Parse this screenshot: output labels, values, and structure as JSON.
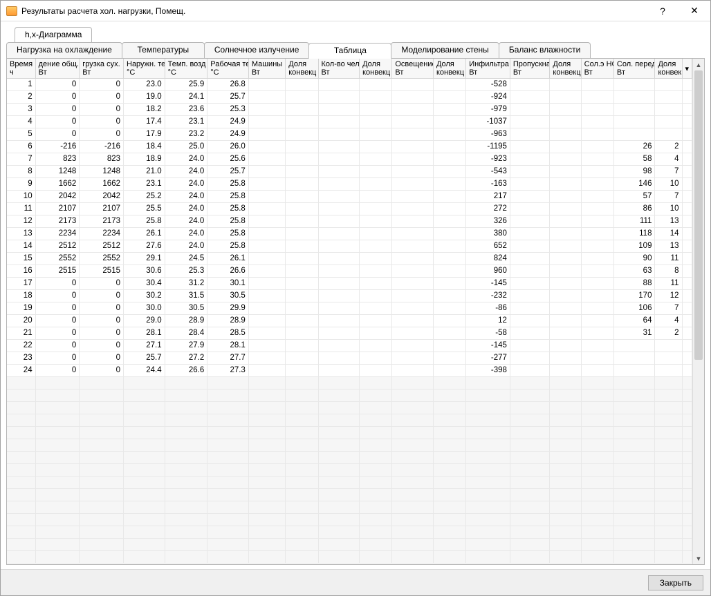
{
  "window": {
    "title": "Результаты расчета хол. нагрузки, Помещ.",
    "help": "?",
    "close": "✕"
  },
  "subtabs": {
    "diagram": "h,x-Диаграмма"
  },
  "tabs": {
    "cooling": "Нагрузка на охлаждение",
    "temps": "Температуры",
    "solar": "Солнечное излучение",
    "table": "Таблица",
    "wall": "Моделирование стены",
    "humidity": "Баланс влажности"
  },
  "columns": [
    {
      "l1": "Время",
      "l2": "ч"
    },
    {
      "l1": "дение общ.",
      "l2": "Вт"
    },
    {
      "l1": "грузка сух.",
      "l2": "Вт"
    },
    {
      "l1": "Наружн. те",
      "l2": "°C"
    },
    {
      "l1": "Темп. возд",
      "l2": "°C"
    },
    {
      "l1": "Рабочая те",
      "l2": "°C"
    },
    {
      "l1": "Машины",
      "l2": "Вт"
    },
    {
      "l1": "Доля",
      "l2": "конвекц"
    },
    {
      "l1": "Кол-во чел.",
      "l2": "Вт"
    },
    {
      "l1": "Доля",
      "l2": "конвекц"
    },
    {
      "l1": "Освещение",
      "l2": "Вт"
    },
    {
      "l1": "Доля",
      "l2": "конвекц"
    },
    {
      "l1": "Инфильтра",
      "l2": "Вт"
    },
    {
      "l1": "Пропускна",
      "l2": "Вт"
    },
    {
      "l1": "Доля",
      "l2": "конвекц"
    },
    {
      "l1": "Сол.э НС",
      "l2": "Вт"
    },
    {
      "l1": "Сол. перед",
      "l2": "Вт"
    },
    {
      "l1": "Доля",
      "l2": "конвекц"
    }
  ],
  "rows": [
    {
      "t": 1,
      "tot": 0,
      "dry": 0,
      "out": "23.0",
      "air": "25.9",
      "op": "26.8",
      "inf": -528,
      "sol": "",
      "kc": ""
    },
    {
      "t": 2,
      "tot": 0,
      "dry": 0,
      "out": "19.0",
      "air": "24.1",
      "op": "25.7",
      "inf": -924,
      "sol": "",
      "kc": ""
    },
    {
      "t": 3,
      "tot": 0,
      "dry": 0,
      "out": "18.2",
      "air": "23.6",
      "op": "25.3",
      "inf": -979,
      "sol": "",
      "kc": ""
    },
    {
      "t": 4,
      "tot": 0,
      "dry": 0,
      "out": "17.4",
      "air": "23.1",
      "op": "24.9",
      "inf": -1037,
      "sol": "",
      "kc": ""
    },
    {
      "t": 5,
      "tot": 0,
      "dry": 0,
      "out": "17.9",
      "air": "23.2",
      "op": "24.9",
      "inf": -963,
      "sol": "",
      "kc": ""
    },
    {
      "t": 6,
      "tot": -216,
      "dry": -216,
      "out": "18.4",
      "air": "25.0",
      "op": "26.0",
      "inf": -1195,
      "sol": 26,
      "kc": 2
    },
    {
      "t": 7,
      "tot": 823,
      "dry": 823,
      "out": "18.9",
      "air": "24.0",
      "op": "25.6",
      "inf": -923,
      "sol": 58,
      "kc": 4
    },
    {
      "t": 8,
      "tot": 1248,
      "dry": 1248,
      "out": "21.0",
      "air": "24.0",
      "op": "25.7",
      "inf": -543,
      "sol": 98,
      "kc": 7
    },
    {
      "t": 9,
      "tot": 1662,
      "dry": 1662,
      "out": "23.1",
      "air": "24.0",
      "op": "25.8",
      "inf": -163,
      "sol": 146,
      "kc": 10
    },
    {
      "t": 10,
      "tot": 2042,
      "dry": 2042,
      "out": "25.2",
      "air": "24.0",
      "op": "25.8",
      "inf": 217,
      "sol": 57,
      "kc": 7
    },
    {
      "t": 11,
      "tot": 2107,
      "dry": 2107,
      "out": "25.5",
      "air": "24.0",
      "op": "25.8",
      "inf": 272,
      "sol": 86,
      "kc": 10
    },
    {
      "t": 12,
      "tot": 2173,
      "dry": 2173,
      "out": "25.8",
      "air": "24.0",
      "op": "25.8",
      "inf": 326,
      "sol": 111,
      "kc": 13
    },
    {
      "t": 13,
      "tot": 2234,
      "dry": 2234,
      "out": "26.1",
      "air": "24.0",
      "op": "25.8",
      "inf": 380,
      "sol": 118,
      "kc": 14
    },
    {
      "t": 14,
      "tot": 2512,
      "dry": 2512,
      "out": "27.6",
      "air": "24.0",
      "op": "25.8",
      "inf": 652,
      "sol": 109,
      "kc": 13
    },
    {
      "t": 15,
      "tot": 2552,
      "dry": 2552,
      "out": "29.1",
      "air": "24.5",
      "op": "26.1",
      "inf": 824,
      "sol": 90,
      "kc": 11
    },
    {
      "t": 16,
      "tot": 2515,
      "dry": 2515,
      "out": "30.6",
      "air": "25.3",
      "op": "26.6",
      "inf": 960,
      "sol": 63,
      "kc": 8
    },
    {
      "t": 17,
      "tot": 0,
      "dry": 0,
      "out": "30.4",
      "air": "31.2",
      "op": "30.1",
      "inf": -145,
      "sol": 88,
      "kc": 11
    },
    {
      "t": 18,
      "tot": 0,
      "dry": 0,
      "out": "30.2",
      "air": "31.5",
      "op": "30.5",
      "inf": -232,
      "sol": 170,
      "kc": 12
    },
    {
      "t": 19,
      "tot": 0,
      "dry": 0,
      "out": "30.0",
      "air": "30.5",
      "op": "29.9",
      "inf": -86,
      "sol": 106,
      "kc": 7
    },
    {
      "t": 20,
      "tot": 0,
      "dry": 0,
      "out": "29.0",
      "air": "28.9",
      "op": "28.9",
      "inf": 12,
      "sol": 64,
      "kc": 4
    },
    {
      "t": 21,
      "tot": 0,
      "dry": 0,
      "out": "28.1",
      "air": "28.4",
      "op": "28.5",
      "inf": -58,
      "sol": 31,
      "kc": 2
    },
    {
      "t": 22,
      "tot": 0,
      "dry": 0,
      "out": "27.1",
      "air": "27.9",
      "op": "28.1",
      "inf": -145,
      "sol": "",
      "kc": ""
    },
    {
      "t": 23,
      "tot": 0,
      "dry": 0,
      "out": "25.7",
      "air": "27.2",
      "op": "27.7",
      "inf": -277,
      "sol": "",
      "kc": ""
    },
    {
      "t": 24,
      "tot": 0,
      "dry": 0,
      "out": "24.4",
      "air": "26.6",
      "op": "27.3",
      "inf": -398,
      "sol": "",
      "kc": ""
    }
  ],
  "emptyRowCount": 15,
  "footer": {
    "close": "Закрыть"
  },
  "dropdown_glyph": "▾"
}
